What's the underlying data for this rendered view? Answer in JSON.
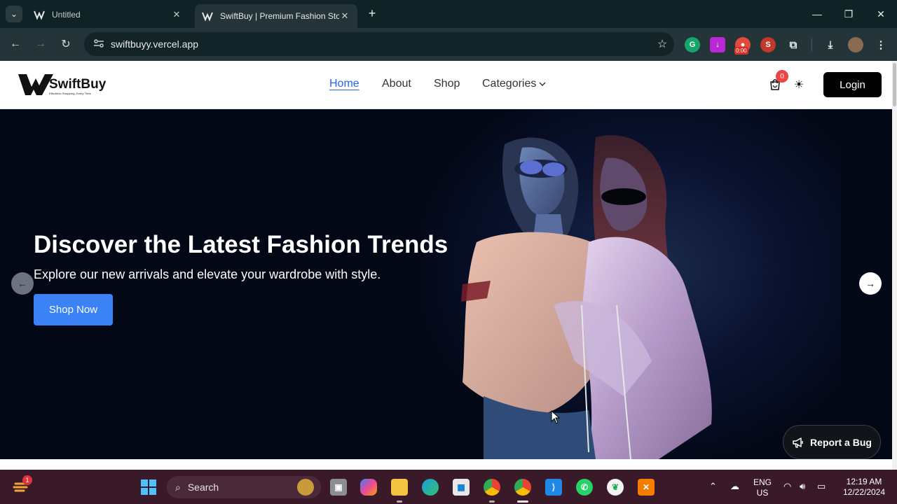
{
  "browser": {
    "tabs": [
      {
        "title": "Untitled",
        "active": false
      },
      {
        "title": "SwiftBuy | Premium Fashion Sto",
        "active": true
      }
    ],
    "url": "swiftbuyy.vercel.app",
    "extension_timer": "0:00"
  },
  "site": {
    "logo_name": "SwiftBuy",
    "logo_tagline": "Effortless Shopping, Every Time",
    "nav": [
      {
        "label": "Home",
        "active": true
      },
      {
        "label": "About",
        "active": false
      },
      {
        "label": "Shop",
        "active": false
      },
      {
        "label": "Categories",
        "active": false
      }
    ],
    "cart_count": "0",
    "login_label": "Login",
    "hero": {
      "title": "Discover the Latest Fashion Trends",
      "subtitle": "Explore our new arrivals and elevate your wardrobe with style.",
      "cta": "Shop Now"
    },
    "report_bug_label": "Report a Bug",
    "accent_color": "#3b82f6"
  },
  "taskbar": {
    "weather_badge": "1",
    "search_placeholder": "Search",
    "language_line1": "ENG",
    "language_line2": "US",
    "time": "12:19 AM",
    "date": "12/22/2024"
  }
}
